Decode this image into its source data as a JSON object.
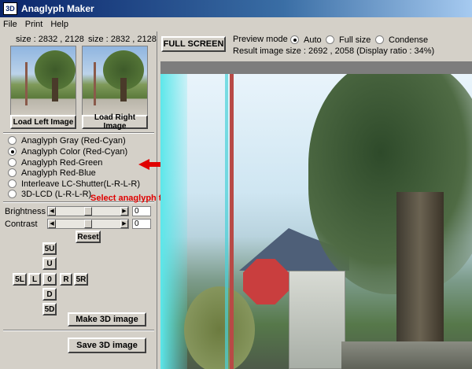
{
  "window": {
    "title": "Anaglyph Maker",
    "icon_label": "3D"
  },
  "menu": [
    "File",
    "Print",
    "Help"
  ],
  "left_panel": {
    "left_size": "size : 2832 , 2128",
    "right_size": "size : 2832 , 2128",
    "load_left": "Load Left Image",
    "load_right": "Load Right Image",
    "anaglyph_types": [
      {
        "label": "Anaglyph Gray (Red-Cyan)",
        "selected": false
      },
      {
        "label": "Anaglyph Color (Red-Cyan)",
        "selected": true
      },
      {
        "label": "Anaglyph Red-Green",
        "selected": false
      },
      {
        "label": "Anaglyph Red-Blue",
        "selected": false
      },
      {
        "label": "Interleave LC-Shutter(L-R-L-R)",
        "selected": false
      },
      {
        "label": "3D-LCD (L-R-L-R)",
        "selected": false
      }
    ],
    "annotation": "Select anaglyph type",
    "brightness": {
      "label": "Brightness",
      "value": "0"
    },
    "contrast": {
      "label": "Contrast",
      "value": "0"
    },
    "reset": "Reset",
    "nudge": {
      "5U": "5U",
      "U": "U",
      "5L": "5L",
      "L": "L",
      "0": "0",
      "R": "R",
      "5R": "5R",
      "D": "D",
      "5D": "5D"
    },
    "make_3d": "Make 3D image",
    "save_3d": "Save 3D image"
  },
  "right_panel": {
    "full_screen": "FULL SCREEN",
    "preview_mode_label": "Preview mode",
    "preview_modes": [
      {
        "label": "Auto",
        "selected": true
      },
      {
        "label": "Full size",
        "selected": false
      },
      {
        "label": "Condense",
        "selected": false
      }
    ],
    "result_size": "Result image size :   2692 , 2058  (Display ratio : 34%)"
  },
  "colors": {
    "accent_red": "#e00000",
    "titlebar": "#0a246a"
  }
}
